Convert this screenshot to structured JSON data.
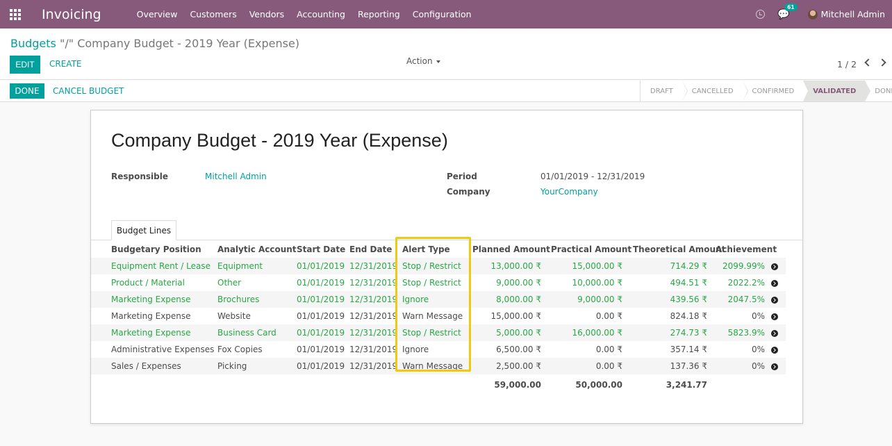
{
  "navbar": {
    "app_name": "Invoicing",
    "menu": [
      "Overview",
      "Customers",
      "Vendors",
      "Accounting",
      "Reporting",
      "Configuration"
    ],
    "messages_count": "61",
    "user_name": "Mitchell Admin",
    "brand_color": "#875a7b"
  },
  "control_panel": {
    "breadcrumb_parent": "Budgets",
    "breadcrumb_sep": "\"/\"",
    "breadcrumb_current": "Company Budget - 2019 Year (Expense)",
    "edit_label": "EDIT",
    "create_label": "CREATE",
    "action_label": "Action",
    "pager": "1 / 2"
  },
  "statusbar": {
    "done_label": "DONE",
    "cancel_label": "CANCEL BUDGET",
    "stages": [
      "DRAFT",
      "CANCELLED",
      "CONFIRMED",
      "VALIDATED",
      "DONE"
    ],
    "active_stage": "VALIDATED"
  },
  "form": {
    "title": "Company Budget - 2019 Year (Expense)",
    "responsible_label": "Responsible",
    "responsible_value": "Mitchell Admin",
    "period_label": "Period",
    "period_value": "01/01/2019 - 12/31/2019",
    "company_label": "Company",
    "company_value": "YourCompany",
    "tab_label": "Budget Lines"
  },
  "table": {
    "headers": [
      "Budgetary Position",
      "Analytic Account",
      "Start Date",
      "End Date",
      "Alert Type",
      "Planned Amount",
      "Practical Amount",
      "Theoretical Amount",
      "Achievement"
    ],
    "rows": [
      {
        "position": "Equipment Rent / Lease",
        "account": "Equipment",
        "start": "01/01/2019",
        "end": "12/31/2019",
        "alert": "Stop / Restrict",
        "planned": "13,000.00 ₹",
        "practical": "15,000.00 ₹",
        "theoretical": "714.29 ₹",
        "achievement": "2099.99%",
        "highlight": true
      },
      {
        "position": "Product / Material",
        "account": "Other",
        "start": "01/01/2019",
        "end": "12/31/2019",
        "alert": "Stop / Restrict",
        "planned": "9,000.00 ₹",
        "practical": "10,000.00 ₹",
        "theoretical": "494.51 ₹",
        "achievement": "2022.2%",
        "highlight": true
      },
      {
        "position": "Marketing Expense",
        "account": "Brochures",
        "start": "01/01/2019",
        "end": "12/31/2019",
        "alert": "Ignore",
        "planned": "8,000.00 ₹",
        "practical": "9,000.00 ₹",
        "theoretical": "439.56 ₹",
        "achievement": "2047.5%",
        "highlight": true
      },
      {
        "position": "Marketing Expense",
        "account": "Website",
        "start": "01/01/2019",
        "end": "12/31/2019",
        "alert": "Warn Message",
        "planned": "15,000.00 ₹",
        "practical": "0.00 ₹",
        "theoretical": "824.18 ₹",
        "achievement": "0%",
        "highlight": false
      },
      {
        "position": "Marketing Expense",
        "account": "Business Card",
        "start": "01/01/2019",
        "end": "12/31/2019",
        "alert": "Stop / Restrict",
        "planned": "5,000.00 ₹",
        "practical": "16,000.00 ₹",
        "theoretical": "274.73 ₹",
        "achievement": "5823.9%",
        "highlight": true
      },
      {
        "position": "Administrative Expenses",
        "account": "Fox Copies",
        "start": "01/01/2019",
        "end": "12/31/2019",
        "alert": "Ignore",
        "planned": "6,500.00 ₹",
        "practical": "0.00 ₹",
        "theoretical": "357.14 ₹",
        "achievement": "0%",
        "highlight": false
      },
      {
        "position": "Sales / Expenses",
        "account": "Picking",
        "start": "01/01/2019",
        "end": "12/31/2019",
        "alert": "Warn Message",
        "planned": "2,500.00 ₹",
        "practical": "0.00 ₹",
        "theoretical": "137.36 ₹",
        "achievement": "0%",
        "highlight": false
      }
    ],
    "totals": {
      "planned": "59,000.00",
      "practical": "50,000.00",
      "theoretical": "3,241.77"
    },
    "over_budget_color": "#28a745",
    "normal_color": "#4c4c4c",
    "highlight_color": "#f2c811"
  }
}
